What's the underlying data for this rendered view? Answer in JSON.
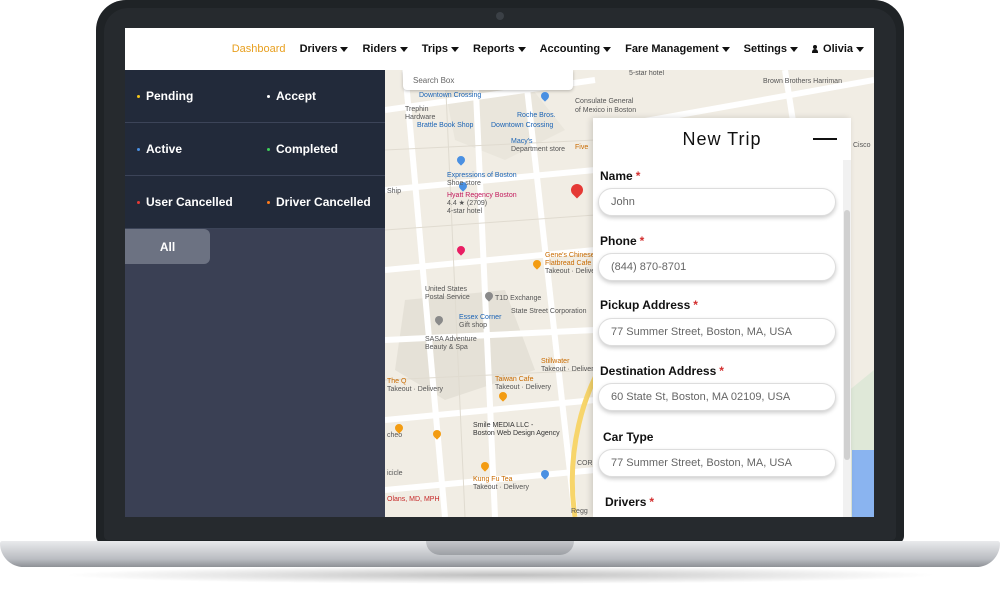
{
  "nav": {
    "items": [
      {
        "label": "Dashboard",
        "active": true,
        "dropdown": false
      },
      {
        "label": "Drivers",
        "dropdown": true
      },
      {
        "label": "Riders",
        "dropdown": true
      },
      {
        "label": "Trips",
        "dropdown": true
      },
      {
        "label": "Reports",
        "dropdown": true
      },
      {
        "label": "Accounting",
        "dropdown": true
      },
      {
        "label": "Fare Management",
        "dropdown": true
      },
      {
        "label": "Settings",
        "dropdown": true
      }
    ],
    "user": "Olivia"
  },
  "statuses": [
    {
      "label": "Pending",
      "color": "#f5c518"
    },
    {
      "label": "Accept",
      "color": "#ffffff"
    },
    {
      "label": "Active",
      "color": "#4a90e2"
    },
    {
      "label": "Completed",
      "color": "#3ecf5a"
    },
    {
      "label": "User Cancelled",
      "color": "#e53935"
    },
    {
      "label": "Driver Cancelled",
      "color": "#ff7a1a"
    }
  ],
  "filter": {
    "all_label": "All"
  },
  "map": {
    "search_placeholder": "Search Box",
    "labels": {
      "trephin": "Trephin",
      "hardware": "Hardware",
      "downtown": "Downtown Crossing",
      "roche": "Roche Bros.",
      "roche2": "Downtown Crossing",
      "consulate": "Consulate General",
      "consulate2": "of Mexico in Boston",
      "brown": "Brown Brothers Harriman",
      "brattle": "Brattle Book Shop",
      "macys": "Macy's",
      "macys2": "Department store",
      "five": "Five",
      "expressions": "Expressions of Boston",
      "expressions2": "Shoe store",
      "hyatt": "Hyatt Regency Boston",
      "hyatt2": "4.4 ★ (2709)",
      "hyatt3": "4-star hotel",
      "genes": "Gene's Chinese",
      "genes2": "Flatbread Cafe",
      "genes3": "Takeout · Delivery",
      "usps": "United States",
      "usps2": "Postal Service",
      "t1d": "T1D Exchange",
      "statestreet": "State Street Corporation",
      "essex": "Essex Corner",
      "essex2": "Gift shop",
      "sasa": "SASA Adventure",
      "sasa2": "Beauty & Spa",
      "stillwater": "Stillwater",
      "stillwater2": "Takeout · Delivery",
      "theq": "The Q",
      "theq2": "Takeout · Delivery",
      "taiwan": "Taiwan Cafe",
      "taiwan2": "Takeout · Delivery",
      "smile": "Smile MEDIA LLC -",
      "smile2": "Boston Web Design Agency",
      "kungfu": "Kung Fu Tea",
      "kungfu2": "Takeout · Delivery",
      "olans": "Olans, MD, MPH",
      "cisco": "Cisco",
      "star": "5-star hotel",
      "shp": "Ship",
      "cor": "COR",
      "regg": "Regg",
      "cheo": "cheo",
      "cicle": "icicle"
    }
  },
  "new_trip": {
    "title": "New Trip",
    "fields": [
      {
        "label": "Name",
        "required": true,
        "value": "John"
      },
      {
        "label": "Phone",
        "required": true,
        "value": "(844) 870-8701"
      },
      {
        "label": "Pickup Address",
        "required": true,
        "value": "77 Summer Street, Boston, MA, USA"
      },
      {
        "label": "Destination Address",
        "required": true,
        "value": "60 State St, Boston, MA 02109, USA"
      },
      {
        "label": "Car Type",
        "required": false,
        "value": "77 Summer Street, Boston, MA, USA"
      },
      {
        "label": "Drivers",
        "required": true,
        "value": ""
      }
    ],
    "required_mark": "*"
  }
}
